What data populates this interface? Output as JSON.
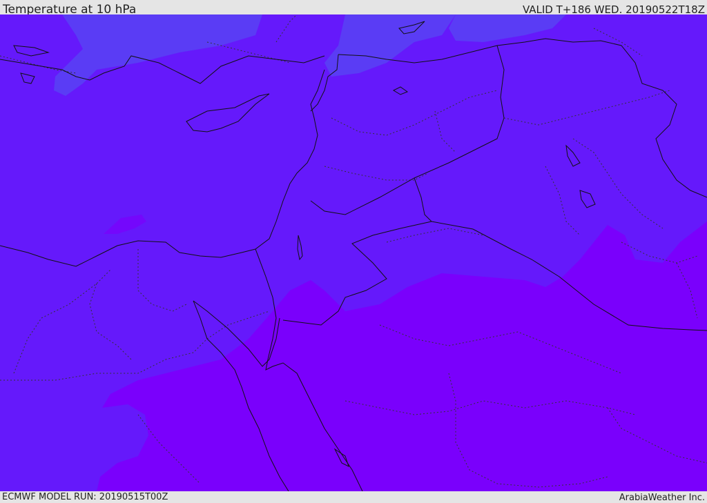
{
  "header": {
    "title": "Temperature at 10 hPa",
    "valid_time": "VALID T+186 WED. 20190522T18Z"
  },
  "footer": {
    "model_run": "ECMWF MODEL RUN: 20190515T00Z",
    "credit": "ArabiaWeather Inc."
  },
  "colors": {
    "band_cold": "#5a3cf5",
    "band_mid": "#6519fb",
    "band_warm": "#7a00fc",
    "coastline": "#111111",
    "border": "#333333"
  },
  "map": {
    "field": "Temperature at 10 hPa",
    "shading": "filled contour bands",
    "overlays": [
      "coastline",
      "country-borders",
      "internal-borders"
    ]
  }
}
